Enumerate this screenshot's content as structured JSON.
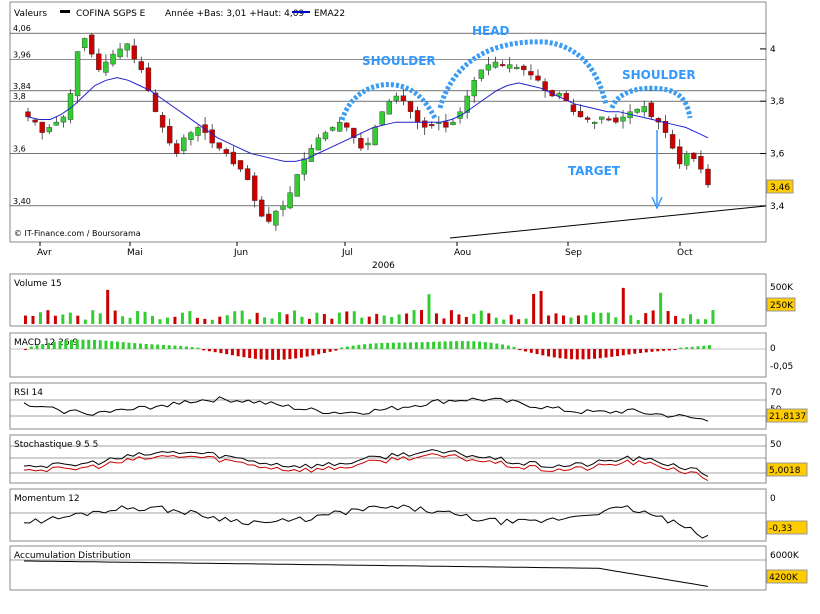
{
  "chart_data": [
    {
      "type": "candlestick",
      "panel": "price",
      "header": {
        "label": "Valeurs",
        "symbol": "COFINA SGPS E",
        "range_text": "Année +Bas: 3,01 +Haut: 4,09",
        "ema_label": "EMA22"
      },
      "credit": "© IT-Finance.com / Boursorama",
      "year_label": "2006",
      "months": [
        "Avr",
        "Mai",
        "Jun",
        "Jul",
        "Aou",
        "Sep",
        "Oct"
      ],
      "left_ticks": [
        "4,06",
        "3,96",
        "3,84",
        "3,8",
        "3,6",
        "3,40"
      ],
      "right_ticks": [
        "4",
        "3,8",
        "3,6",
        "3,4"
      ],
      "last_value": "3,46",
      "ylim": [
        3.3,
        4.08
      ],
      "close": [
        3.74,
        3.72,
        3.68,
        3.7,
        3.72,
        3.74,
        3.83,
        3.99,
        4.04,
        3.98,
        3.92,
        3.95,
        3.98,
        4.0,
        4.02,
        3.96,
        3.92,
        3.84,
        3.76,
        3.7,
        3.64,
        3.6,
        3.66,
        3.68,
        3.7,
        3.68,
        3.64,
        3.62,
        3.6,
        3.56,
        3.54,
        3.5,
        3.42,
        3.36,
        3.34,
        3.38,
        3.4,
        3.45,
        3.52,
        3.58,
        3.62,
        3.66,
        3.68,
        3.7,
        3.72,
        3.7,
        3.66,
        3.62,
        3.64,
        3.7,
        3.76,
        3.8,
        3.82,
        3.8,
        3.76,
        3.72,
        3.7,
        3.71,
        3.72,
        3.7,
        3.72,
        3.76,
        3.82,
        3.88,
        3.92,
        3.94,
        3.95,
        3.94,
        3.94,
        3.93,
        3.92,
        3.9,
        3.88,
        3.84,
        3.82,
        3.83,
        3.8,
        3.76,
        3.74,
        3.73,
        3.72,
        3.74,
        3.73,
        3.72,
        3.74,
        3.76,
        3.77,
        3.78,
        3.74,
        3.72,
        3.68,
        3.62,
        3.56,
        3.6,
        3.58,
        3.54,
        3.48
      ],
      "ema22": [
        3.74,
        3.73,
        3.73,
        3.75,
        3.78,
        3.82,
        3.86,
        3.88,
        3.89,
        3.88,
        3.86,
        3.84,
        3.81,
        3.78,
        3.75,
        3.72,
        3.69,
        3.66,
        3.64,
        3.62,
        3.6,
        3.59,
        3.58,
        3.57,
        3.57,
        3.58,
        3.6,
        3.62,
        3.64,
        3.66,
        3.68,
        3.7,
        3.71,
        3.72,
        3.72,
        3.72,
        3.72,
        3.72,
        3.73,
        3.75,
        3.78,
        3.81,
        3.84,
        3.86,
        3.87,
        3.86,
        3.85,
        3.83,
        3.81,
        3.79,
        3.78,
        3.77,
        3.76,
        3.76,
        3.75,
        3.74,
        3.73,
        3.72,
        3.71,
        3.7,
        3.68,
        3.66
      ]
    },
    {
      "type": "bar",
      "panel": "volume",
      "title": "Volume 15",
      "ticks": [
        "500K"
      ],
      "last_value": "250K"
    },
    {
      "type": "bar",
      "panel": "macd",
      "title": "MACD 12 26 9",
      "ticks": [
        "0",
        "-0,05"
      ]
    },
    {
      "type": "line",
      "panel": "rsi",
      "title": "RSI 14",
      "ticks": [
        "70",
        "50"
      ],
      "last_value": "21,8137"
    },
    {
      "type": "line",
      "panel": "stochastic",
      "title": "Stochastique 9 5 5",
      "ticks": [
        "50"
      ],
      "last_value": "5,0018"
    },
    {
      "type": "line",
      "panel": "momentum",
      "title": "Momentum 12",
      "ticks": [
        "0"
      ],
      "last_value": "-0,33"
    },
    {
      "type": "line",
      "panel": "accumulation",
      "title": "Accumulation Distribution",
      "ticks": [
        "6000K"
      ],
      "last_value": "4200K"
    }
  ],
  "annotations": {
    "shoulder_left": "SHOULDER",
    "head": "HEAD",
    "shoulder_right": "SHOULDER",
    "target": "TARGET"
  },
  "colors": {
    "up": "#33cc33",
    "down": "#cc0000",
    "ema": "#0000cc",
    "annotation": "#3399ff",
    "value_box": "#ffcc00"
  }
}
